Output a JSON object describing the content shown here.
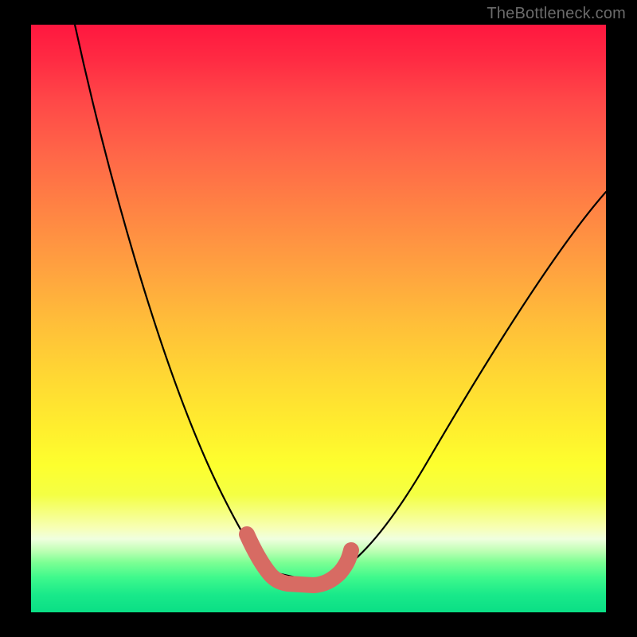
{
  "watermark": "TheBottleneck.com",
  "colors": {
    "background": "#000000",
    "gradient_top": "#ff173f",
    "gradient_mid": "#ffef2e",
    "gradient_bottom": "#0adf85",
    "curve": "#000000",
    "highlight": "#d76b63",
    "watermark": "#6b6b6b"
  },
  "chart_data": {
    "type": "line",
    "title": "",
    "xlabel": "",
    "ylabel": "",
    "xlim": [
      0,
      100
    ],
    "ylim": [
      0,
      100
    ],
    "grid": false,
    "legend": false,
    "background_gradient": {
      "orientation": "vertical",
      "stops": [
        {
          "pos": 0.0,
          "color": "#ff173f"
        },
        {
          "pos": 0.22,
          "color": "#ff6648"
        },
        {
          "pos": 0.51,
          "color": "#ffbf39"
        },
        {
          "pos": 0.75,
          "color": "#fdff2e"
        },
        {
          "pos": 0.88,
          "color": "#f0ffdf"
        },
        {
          "pos": 1.0,
          "color": "#0adf85"
        }
      ]
    },
    "series": [
      {
        "name": "main-curve",
        "color": "#000000",
        "stroke_width": 2.2,
        "x": [
          8,
          12,
          18,
          24,
          30,
          35,
          40,
          44,
          48,
          52,
          56,
          62,
          70,
          80,
          92,
          100
        ],
        "y": [
          100,
          80,
          60,
          42,
          28,
          18,
          11,
          7,
          5,
          6,
          8,
          15,
          30,
          48,
          64,
          72
        ]
      },
      {
        "name": "bottom-highlight",
        "color": "#d76b63",
        "stroke_width": 20,
        "x": [
          38,
          40,
          42,
          45,
          48,
          51,
          54,
          56
        ],
        "y": [
          13,
          9,
          6,
          5,
          5,
          6,
          8,
          11
        ]
      }
    ],
    "annotations": [
      {
        "text": "TheBottleneck.com",
        "position": "top-right",
        "color": "#6b6b6b"
      }
    ]
  }
}
